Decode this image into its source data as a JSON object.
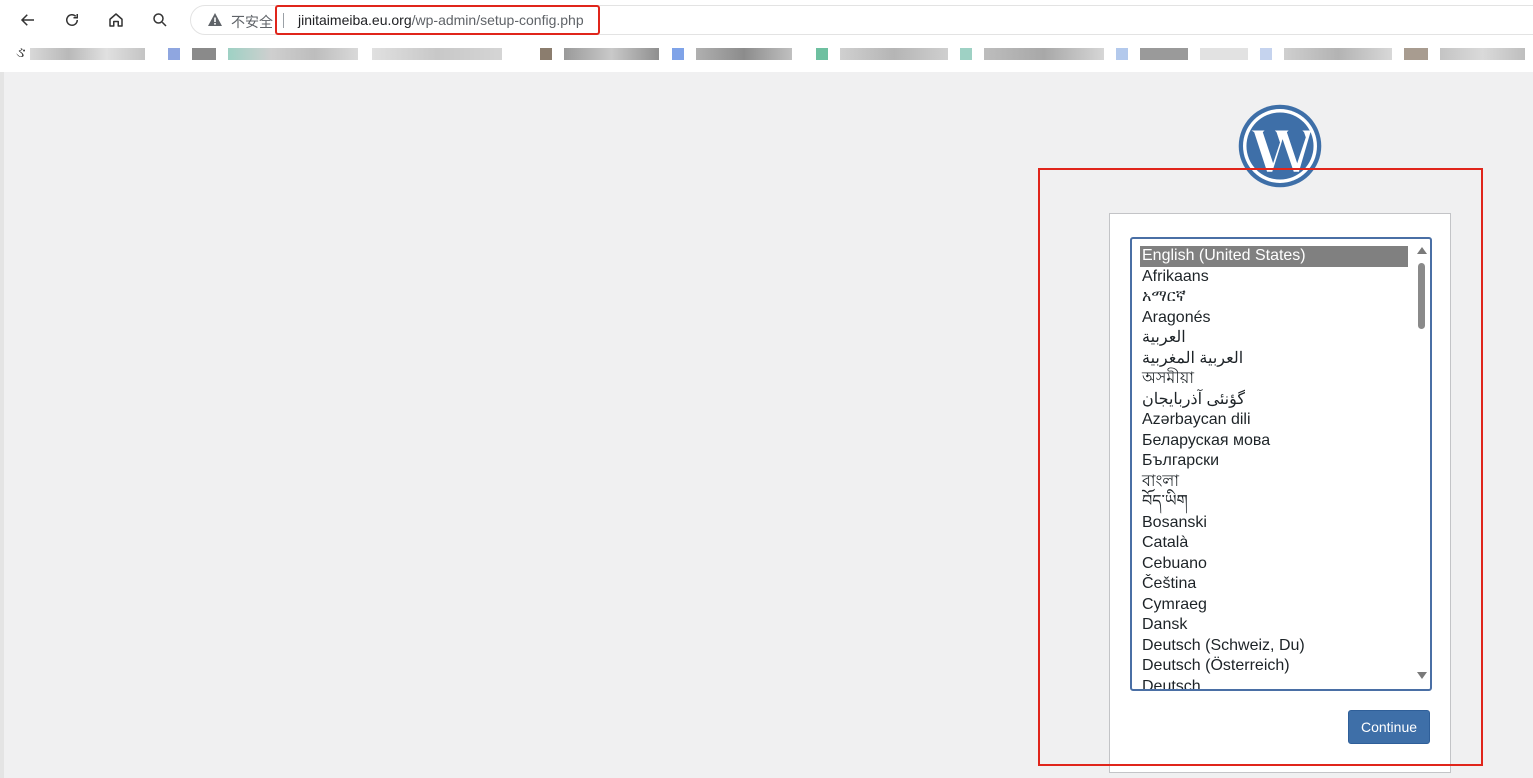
{
  "browser": {
    "security_label": "不安全",
    "url_host": "jinitaimeiba.eu.org",
    "url_path": "/wp-admin/setup-config.php",
    "bookmark_glyph": "ઙ"
  },
  "setup": {
    "languages": [
      "English (United States)",
      "Afrikaans",
      "አማርኛ",
      "Aragonés",
      "العربية",
      "العربية المغربية",
      "অসমীয়া",
      "گؤنئی آذربایجان",
      "Azərbaycan dili",
      "Беларуская мова",
      "Български",
      "বাংলা",
      "བོད་ཡིག",
      "Bosanski",
      "Català",
      "Cebuano",
      "Čeština",
      "Cymraeg",
      "Dansk",
      "Deutsch (Schweiz, Du)",
      "Deutsch (Österreich)",
      "Deutsch"
    ],
    "selected_language": "English (United States)",
    "continue_label": "Continue"
  },
  "colors": {
    "wp_blue": "#3e6fa8",
    "highlight_red": "#e0251b",
    "selected_bg": "#808080"
  }
}
